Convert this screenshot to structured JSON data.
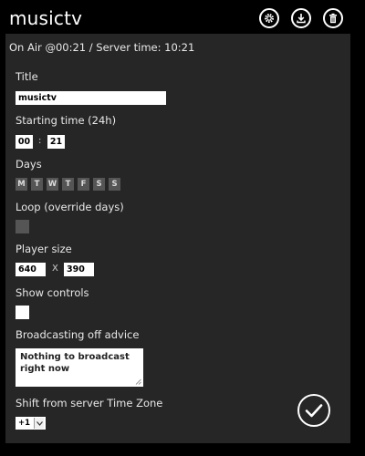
{
  "app": {
    "title": "musictv"
  },
  "toolbar": {
    "settings_icon": "gear-icon",
    "download_icon": "download-icon",
    "delete_icon": "trash-icon"
  },
  "status": {
    "text": "On Air @00:21 / Server time: 10:21"
  },
  "form": {
    "title_label": "Title",
    "title_value": "musictv",
    "start_label": "Starting time (24h)",
    "start_hour": "00",
    "start_separator": ":",
    "start_minute": "21",
    "days_label": "Days",
    "days": [
      "M",
      "T",
      "W",
      "T",
      "F",
      "S",
      "S"
    ],
    "loop_label": "Loop (override days)",
    "loop_checked": false,
    "player_label": "Player size",
    "player_width": "640",
    "player_times": "X",
    "player_height": "390",
    "controls_label": "Show controls",
    "controls_checked": true,
    "advice_label": "Broadcasting off advice",
    "advice_value": "Nothing to broadcast right now",
    "shift_label": "Shift from server Time Zone",
    "shift_value": "+1"
  },
  "colors": {
    "background": "#000000",
    "panel": "#262626",
    "day_chip": "#555555",
    "text": "#e8e8e8",
    "input": "#ffffff"
  }
}
